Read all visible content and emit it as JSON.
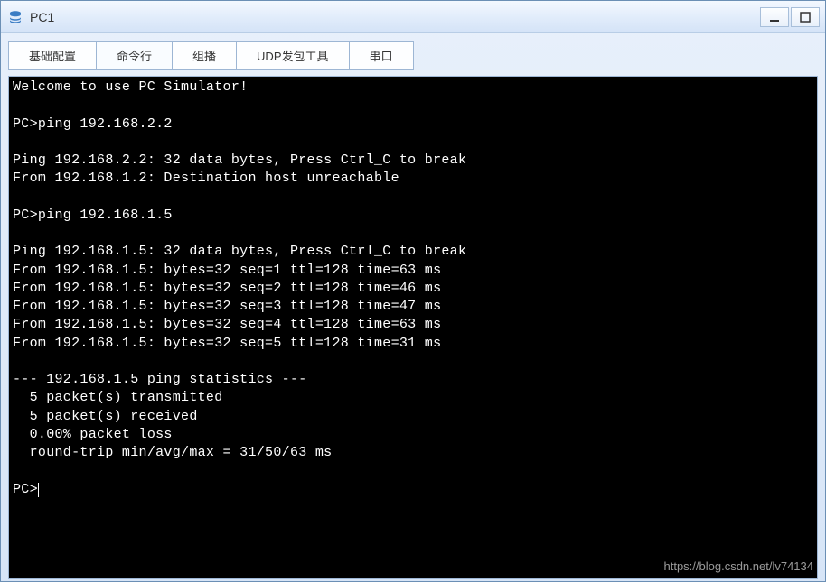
{
  "window": {
    "title": "PC1"
  },
  "tabs": [
    {
      "label": "基础配置"
    },
    {
      "label": "命令行"
    },
    {
      "label": "组播"
    },
    {
      "label": "UDP发包工具"
    },
    {
      "label": "串口"
    }
  ],
  "active_tab_index": 1,
  "terminal": {
    "lines": [
      "Welcome to use PC Simulator!",
      "",
      "PC>ping 192.168.2.2",
      "",
      "Ping 192.168.2.2: 32 data bytes, Press Ctrl_C to break",
      "From 192.168.1.2: Destination host unreachable",
      "",
      "PC>ping 192.168.1.5",
      "",
      "Ping 192.168.1.5: 32 data bytes, Press Ctrl_C to break",
      "From 192.168.1.5: bytes=32 seq=1 ttl=128 time=63 ms",
      "From 192.168.1.5: bytes=32 seq=2 ttl=128 time=46 ms",
      "From 192.168.1.5: bytes=32 seq=3 ttl=128 time=47 ms",
      "From 192.168.1.5: bytes=32 seq=4 ttl=128 time=63 ms",
      "From 192.168.1.5: bytes=32 seq=5 ttl=128 time=31 ms",
      "",
      "--- 192.168.1.5 ping statistics ---",
      "  5 packet(s) transmitted",
      "  5 packet(s) received",
      "  0.00% packet loss",
      "  round-trip min/avg/max = 31/50/63 ms",
      "",
      "PC>"
    ]
  },
  "watermark": "https://blog.csdn.net/lv74134"
}
